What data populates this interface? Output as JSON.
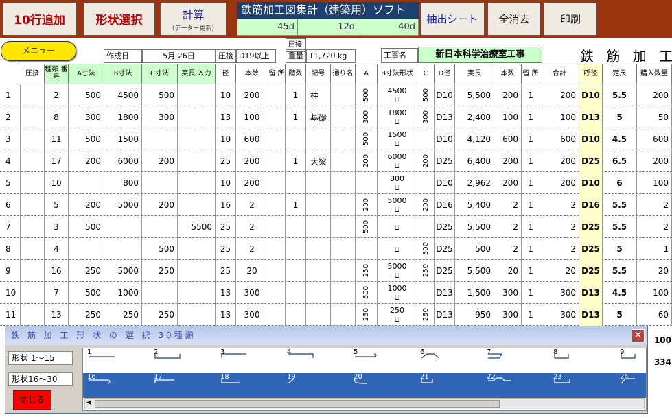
{
  "toolbar": {
    "add_rows": "10行追加",
    "select_shape": "形状選択",
    "calc": "計算",
    "calc_sub": "（データー更新）",
    "extract": "抽出シート",
    "clear_all": "全消去",
    "print": "印刷"
  },
  "app": {
    "title": "鉄筋加工図集計（建築用）ソフト",
    "counts": [
      "45d",
      "12d",
      "40d"
    ]
  },
  "menu": "メニュー",
  "info": {
    "created_label": "作成日",
    "created_value": "5月 26日",
    "pressure_label": "圧接",
    "pressure_value": "D19以上",
    "weight_top": "圧接",
    "weight_label": "重量",
    "weight_value": "11,720 kg",
    "project_label": "工事名",
    "project_value": "新日本科学治療室工事",
    "sheet_title": "鉄 筋 加 工"
  },
  "headers": [
    "圧接",
    "種類 番号",
    "A寸法",
    "B寸法",
    "C寸法",
    "実長 入力",
    "径",
    "本数",
    "留 所",
    "階数",
    "記号",
    "通り名",
    "A",
    "B寸法形状",
    "C",
    "D径",
    "実長",
    "本数",
    "留 所",
    "合計",
    "呼径",
    "定尺",
    "購入数量"
  ],
  "rows": [
    {
      "n": "1",
      "type": "2",
      "a": "500",
      "b": "4500",
      "c": "500",
      "len_in": "",
      "dia": "10",
      "qty": "200",
      "floor": "1",
      "mark": "柱",
      "da": "500",
      "db": "4500",
      "dc": "500",
      "d": "D10",
      "real": "5,500",
      "qty2": "200",
      "st": "1",
      "total": "200",
      "call": "D10",
      "std": "5.5",
      "buy": "200"
    },
    {
      "n": "2",
      "type": "8",
      "a": "300",
      "b": "1800",
      "c": "300",
      "len_in": "",
      "dia": "13",
      "qty": "100",
      "floor": "1",
      "mark": "基礎",
      "da": "300",
      "db": "1800",
      "dc": "300",
      "d": "D13",
      "real": "2,400",
      "qty2": "100",
      "st": "1",
      "total": "100",
      "call": "D13",
      "std": "5",
      "buy": "50"
    },
    {
      "n": "3",
      "type": "11",
      "a": "500",
      "b": "1500",
      "c": "",
      "len_in": "",
      "dia": "10",
      "qty": "600",
      "floor": "",
      "mark": "",
      "da": "500",
      "db": "1500",
      "dc": "",
      "d": "D10",
      "real": "4,120",
      "qty2": "600",
      "st": "1",
      "total": "600",
      "call": "D10",
      "std": "4.5",
      "buy": "600"
    },
    {
      "n": "4",
      "type": "17",
      "a": "200",
      "b": "6000",
      "c": "200",
      "len_in": "",
      "dia": "25",
      "qty": "200",
      "floor": "1",
      "mark": "大梁",
      "da": "200",
      "db": "6000",
      "dc": "200",
      "d": "D25",
      "real": "6,400",
      "qty2": "200",
      "st": "1",
      "total": "200",
      "call": "D25",
      "std": "6.5",
      "buy": "200"
    },
    {
      "n": "5",
      "type": "10",
      "a": "",
      "b": "800",
      "c": "",
      "len_in": "",
      "dia": "10",
      "qty": "200",
      "floor": "",
      "mark": "",
      "da": "",
      "db": "800",
      "dc": "",
      "d": "D10",
      "real": "2,962",
      "qty2": "200",
      "st": "1",
      "total": "200",
      "call": "D10",
      "std": "6",
      "buy": "100"
    },
    {
      "n": "6",
      "type": "5",
      "a": "200",
      "b": "5000",
      "c": "200",
      "len_in": "",
      "dia": "16",
      "qty": "2",
      "floor": "1",
      "mark": "",
      "da": "200",
      "db": "5000",
      "dc": "200",
      "d": "D16",
      "real": "5,400",
      "qty2": "2",
      "st": "1",
      "total": "2",
      "call": "D16",
      "std": "5.5",
      "buy": "2"
    },
    {
      "n": "7",
      "type": "3",
      "a": "500",
      "b": "",
      "c": "",
      "len_in": "5500",
      "dia": "25",
      "qty": "2",
      "floor": "",
      "mark": "",
      "da": "500",
      "db": "",
      "dc": "",
      "d": "D25",
      "real": "5,500",
      "qty2": "2",
      "st": "1",
      "total": "2",
      "call": "D25",
      "std": "5.5",
      "buy": "2"
    },
    {
      "n": "8",
      "type": "4",
      "a": "",
      "b": "",
      "c": "500",
      "len_in": "",
      "dia": "25",
      "qty": "2",
      "floor": "",
      "mark": "",
      "da": "",
      "db": "",
      "dc": "500",
      "d": "D25",
      "real": "500",
      "qty2": "2",
      "st": "1",
      "total": "2",
      "call": "D25",
      "std": "5",
      "buy": "1"
    },
    {
      "n": "9",
      "type": "16",
      "a": "250",
      "b": "5000",
      "c": "250",
      "len_in": "",
      "dia": "25",
      "qty": "20",
      "floor": "",
      "mark": "",
      "da": "250",
      "db": "5000",
      "dc": "250",
      "d": "D25",
      "real": "5,500",
      "qty2": "20",
      "st": "1",
      "total": "20",
      "call": "D25",
      "std": "5.5",
      "buy": "20"
    },
    {
      "n": "10",
      "type": "7",
      "a": "500",
      "b": "1000",
      "c": "",
      "len_in": "",
      "dia": "13",
      "qty": "300",
      "floor": "",
      "mark": "",
      "da": "500",
      "db": "1000",
      "dc": "",
      "d": "D13",
      "real": "1,500",
      "qty2": "300",
      "st": "1",
      "total": "300",
      "call": "D13",
      "std": "4.5",
      "buy": "100"
    },
    {
      "n": "11",
      "type": "13",
      "a": "250",
      "b": "250",
      "c": "250",
      "len_in": "",
      "dia": "13",
      "qty": "300",
      "floor": "",
      "mark": "",
      "da": "250",
      "db": "250",
      "dc": "250",
      "d": "D13",
      "real": "950",
      "qty2": "300",
      "st": "1",
      "total": "300",
      "call": "D13",
      "std": "5",
      "buy": "60"
    }
  ],
  "extra_buy": [
    "100",
    "334"
  ],
  "dialog": {
    "title": "鉄 筋 加 工 形 状 の 選 択  30種類",
    "group1": "形状  1〜15",
    "group2": "形状16〜30",
    "close": "閉じる",
    "row1": [
      "1",
      "2",
      "3",
      "4",
      "5",
      "6",
      "7",
      "8",
      "9"
    ],
    "row2": [
      "16",
      "17",
      "18",
      "19",
      "20",
      "21",
      "22",
      "23",
      "24"
    ]
  }
}
